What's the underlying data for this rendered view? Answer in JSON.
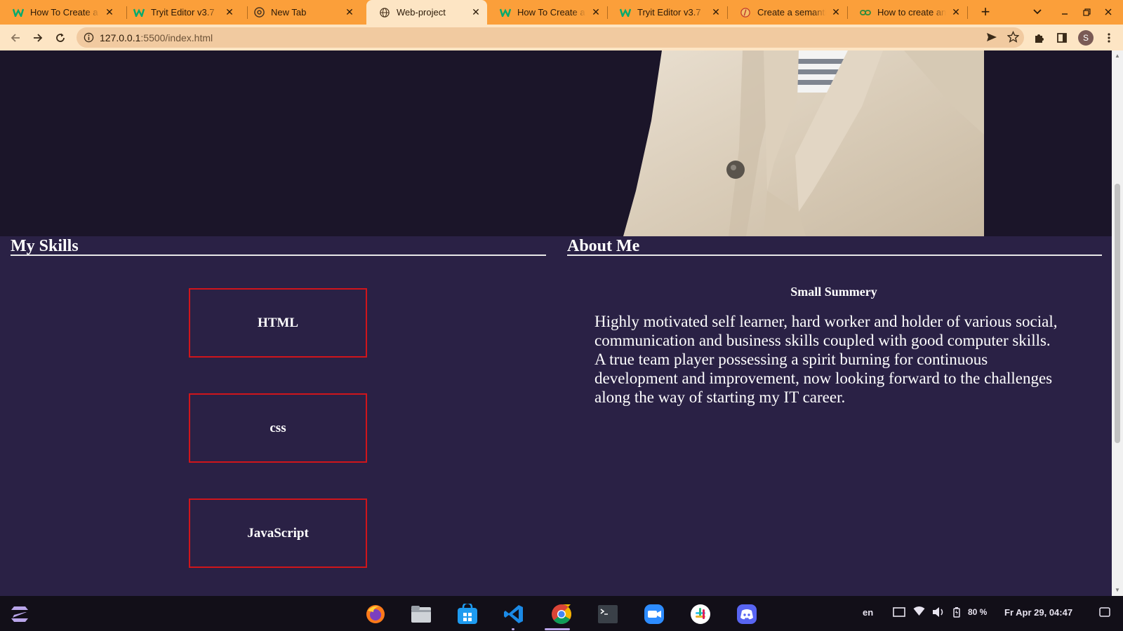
{
  "browser": {
    "tabs": [
      {
        "title": "How To Create a",
        "favicon": "w3schools-icon",
        "active": false
      },
      {
        "title": "Tryit Editor v3.7",
        "favicon": "w3schools-icon",
        "active": false
      },
      {
        "title": "New Tab",
        "favicon": "chrome-icon",
        "active": false
      },
      {
        "title": "Web-project",
        "favicon": "globe-icon",
        "active": true
      },
      {
        "title": "How To Create a",
        "favicon": "w3schools-icon",
        "active": false
      },
      {
        "title": "Tryit Editor v3.7",
        "favicon": "w3schools-icon",
        "active": false
      },
      {
        "title": "Create a semanti",
        "favicon": "semantic-icon",
        "active": false
      },
      {
        "title": "How to create an",
        "favicon": "link-icon",
        "active": false
      }
    ],
    "url_host": "127.0.0.1",
    "url_path": ":5500/index.html",
    "profile_initial": "S",
    "tabstrip_color": "#fb9f3a",
    "toolbar_color": "#fde5c4"
  },
  "page": {
    "skills_heading": "My Skills",
    "about_heading": "About Me",
    "skills": [
      "HTML",
      "css",
      "JavaScript"
    ],
    "summary_title": "Small Summery",
    "summary_text": "Highly motivated self learner, hard worker and holder of various social, communication and business skills coupled with good computer skills. A true team player possessing a spirit burning for continuous development and improvement, now looking forward to the challenges along the way of starting my IT career.",
    "skill_border_color": "#d0151b",
    "background_color": "#2a2145"
  },
  "taskbar": {
    "apps": [
      "firefox-icon",
      "files-icon",
      "software-store-icon",
      "vscode-icon",
      "chrome-icon",
      "terminal-icon",
      "zoom-icon",
      "slack-icon",
      "discord-icon"
    ],
    "language": "en",
    "battery": "80 %",
    "datetime": "Fr Apr 29, 04:47"
  }
}
